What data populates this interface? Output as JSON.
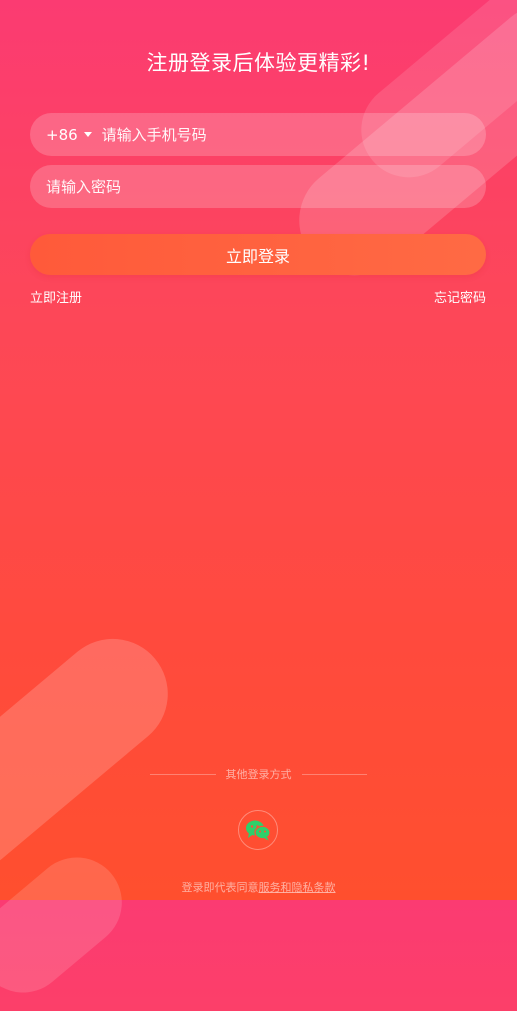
{
  "header": {
    "title": "注册登录后体验更精彩!"
  },
  "phone": {
    "country_code": "+86",
    "placeholder": "请输入手机号码",
    "value": ""
  },
  "password": {
    "placeholder": "请输入密码",
    "value": ""
  },
  "login_label": "立即登录",
  "links": {
    "register": "立即注册",
    "forgot": "忘记密码"
  },
  "other_login": {
    "label": "其他登录方式",
    "wechat_icon": "wechat-icon",
    "wechat_color": "#2ed06a"
  },
  "agreement": {
    "prefix": "登录即代表同意",
    "terms": "服务和隐私条款"
  },
  "colors": {
    "bg_top": "#fb3b72",
    "bg_bottom": "#ff4f2e",
    "button": "#ff5f3f"
  }
}
